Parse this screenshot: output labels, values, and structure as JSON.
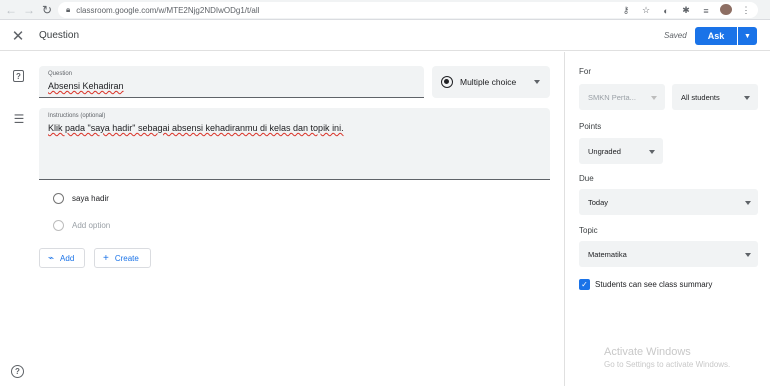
{
  "browser": {
    "url": "classroom.google.com/w/MTE2Njg2NDIwODg1/t/all",
    "back_icon": "arrow-left",
    "forward_icon": "arrow-right",
    "reload_icon": "reload"
  },
  "appbar": {
    "title": "Question",
    "saved_label": "Saved",
    "ask_label": "Ask"
  },
  "question": {
    "label": "Question",
    "value": "Absensi Kehadiran"
  },
  "type_select": {
    "value": "Multiple choice"
  },
  "instructions": {
    "label": "Instructions (optional)",
    "value": "Klik pada \"saya hadir\" sebagai absensi kehadiranmu di kelas dan topik ini."
  },
  "options": [
    {
      "label": "saya hadir"
    },
    {
      "label": "Add option"
    }
  ],
  "buttons": {
    "add_label": "Add",
    "create_label": "Create"
  },
  "sidebar": {
    "for_label": "For",
    "class_value": "SMKN Perta...",
    "students_value": "All students",
    "points_label": "Points",
    "points_value": "Ungraded",
    "due_label": "Due",
    "due_value": "Today",
    "topic_label": "Topic",
    "topic_value": "Matematika",
    "summary_label": "Students can see class summary",
    "summary_checked": true
  },
  "watermark": {
    "title": "Activate Windows",
    "subtitle": "Go to Settings to activate Windows."
  },
  "colors": {
    "accent": "#1a73e8",
    "field_bg": "#f1f3f4"
  }
}
